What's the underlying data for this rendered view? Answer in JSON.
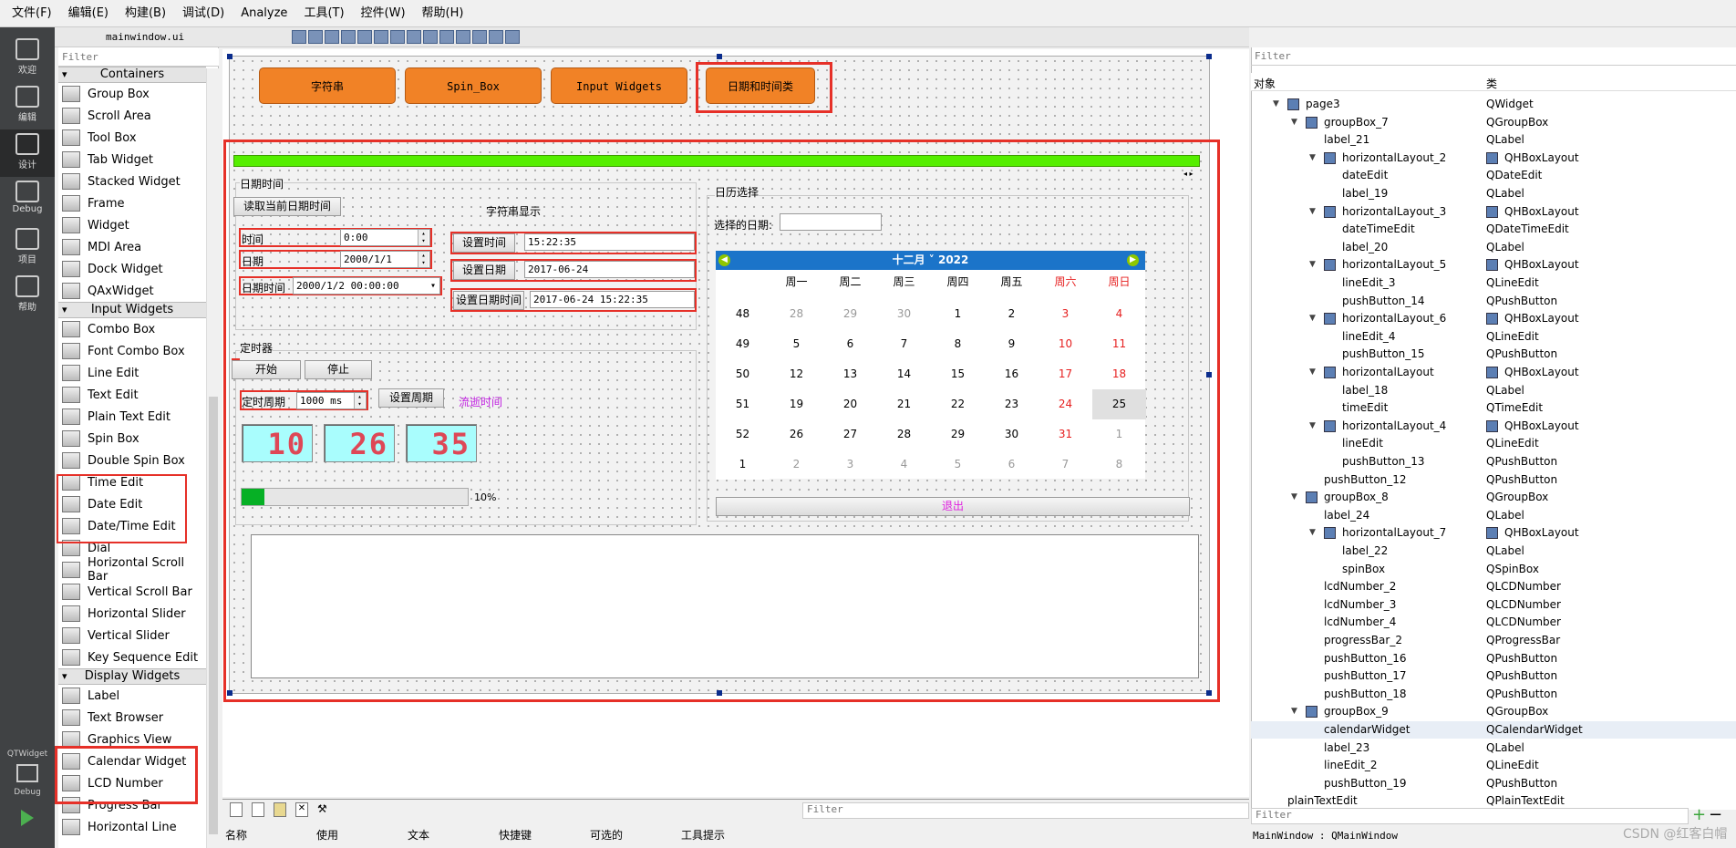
{
  "menubar": [
    "文件(F)",
    "编辑(E)",
    "构建(B)",
    "调试(D)",
    "Analyze",
    "工具(T)",
    "控件(W)",
    "帮助(H)"
  ],
  "modes": [
    {
      "label": "欢迎"
    },
    {
      "label": "编辑"
    },
    {
      "label": "设计",
      "selected": true
    },
    {
      "label": "Debug"
    },
    {
      "label": "项目"
    },
    {
      "label": "帮助"
    }
  ],
  "kit": {
    "name": "QTWidget",
    "label": "Debug"
  },
  "widgetbox": {
    "filter_placeholder": "Filter",
    "categories": [
      {
        "name": "Containers",
        "items": [
          "Group Box",
          "Scroll Area",
          "Tool Box",
          "Tab Widget",
          "Stacked Widget",
          "Frame",
          "Widget",
          "MDI Area",
          "Dock Widget",
          "QAxWidget"
        ]
      },
      {
        "name": "Input Widgets",
        "items": [
          "Combo Box",
          "Font Combo Box",
          "Line Edit",
          "Text Edit",
          "Plain Text Edit",
          "Spin Box",
          "Double Spin Box",
          "Time Edit",
          "Date Edit",
          "Date/Time Edit",
          "Dial",
          "Horizontal Scroll Bar",
          "Vertical Scroll Bar",
          "Horizontal Slider",
          "Vertical Slider",
          "Key Sequence Edit"
        ]
      },
      {
        "name": "Display Widgets",
        "items": [
          "Label",
          "Text Browser",
          "Graphics View",
          "Calendar Widget",
          "LCD Number",
          "Progress Bar",
          "Horizontal Line"
        ]
      }
    ]
  },
  "editor": {
    "file": "mainwindow.ui"
  },
  "form": {
    "tabs": [
      "字符串",
      "Spin_Box",
      "Input Widgets",
      "日期和时间类"
    ],
    "datetime_group": {
      "title": "日期时间",
      "read_button": "读取当前日期时间",
      "string_title": "字符串显示",
      "time_label": "时间",
      "time_value": "0:00",
      "date_label": "日期",
      "date_value": "2000/1/1",
      "datetime_label": "日期时间",
      "datetime_value": "2000/1/2 00:00:00",
      "set_time_button": "设置时间",
      "set_time_value": "15:22:35",
      "set_date_button": "设置日期",
      "set_date_value": "2017-06-24",
      "set_datetime_button": "设置日期时间",
      "set_datetime_value": "2017-06-24 15:22:35"
    },
    "timer_group": {
      "title": "定时器",
      "start": "开始",
      "stop": "停止",
      "period_label": "定时周期",
      "period_value": "1000 ms",
      "set_period": "设置周期",
      "elapsed": "流逝时间",
      "lcd": [
        "10",
        "26",
        "35"
      ],
      "progress": 0.1,
      "progress_text": "10%"
    },
    "calendar_group": {
      "title": "日历选择",
      "date_label": "选择的日期:",
      "date_value": "",
      "month": "十二月",
      "year": "2022",
      "weekdays": [
        "周一",
        "周二",
        "周三",
        "周四",
        "周五",
        "周六",
        "周日"
      ],
      "weeks": [
        "48",
        "49",
        "50",
        "51",
        "52",
        "1"
      ],
      "days": [
        [
          "28",
          "29",
          "30",
          "1",
          "2",
          "3",
          "4"
        ],
        [
          "5",
          "6",
          "7",
          "8",
          "9",
          "10",
          "11"
        ],
        [
          "12",
          "13",
          "14",
          "15",
          "16",
          "17",
          "18"
        ],
        [
          "19",
          "20",
          "21",
          "22",
          "23",
          "24",
          "25"
        ],
        [
          "26",
          "27",
          "28",
          "29",
          "30",
          "31",
          "1"
        ],
        [
          "2",
          "3",
          "4",
          "5",
          "6",
          "7",
          "8"
        ]
      ],
      "exit_button": "退出"
    }
  },
  "object_inspector": {
    "filter_placeholder": "Filter",
    "headers": [
      "对象",
      "类"
    ],
    "rows": [
      [
        "page3",
        "QWidget"
      ],
      [
        "groupBox_7",
        "QGroupBox"
      ],
      [
        "label_21",
        "QLabel"
      ],
      [
        "horizontalLayout_2",
        "QHBoxLayout"
      ],
      [
        "dateEdit",
        "QDateEdit"
      ],
      [
        "label_19",
        "QLabel"
      ],
      [
        "horizontalLayout_3",
        "QHBoxLayout"
      ],
      [
        "dateTimeEdit",
        "QDateTimeEdit"
      ],
      [
        "label_20",
        "QLabel"
      ],
      [
        "horizontalLayout_5",
        "QHBoxLayout"
      ],
      [
        "lineEdit_3",
        "QLineEdit"
      ],
      [
        "pushButton_14",
        "QPushButton"
      ],
      [
        "horizontalLayout_6",
        "QHBoxLayout"
      ],
      [
        "lineEdit_4",
        "QLineEdit"
      ],
      [
        "pushButton_15",
        "QPushButton"
      ],
      [
        "horizontalLayout",
        "QHBoxLayout"
      ],
      [
        "label_18",
        "QLabel"
      ],
      [
        "timeEdit",
        "QTimeEdit"
      ],
      [
        "horizontalLayout_4",
        "QHBoxLayout"
      ],
      [
        "lineEdit",
        "QLineEdit"
      ],
      [
        "pushButton_13",
        "QPushButton"
      ],
      [
        "pushButton_12",
        "QPushButton"
      ],
      [
        "groupBox_8",
        "QGroupBox"
      ],
      [
        "label_24",
        "QLabel"
      ],
      [
        "horizontalLayout_7",
        "QHBoxLayout"
      ],
      [
        "label_22",
        "QLabel"
      ],
      [
        "spinBox",
        "QSpinBox"
      ],
      [
        "lcdNumber_2",
        "QLCDNumber"
      ],
      [
        "lcdNumber_3",
        "QLCDNumber"
      ],
      [
        "lcdNumber_4",
        "QLCDNumber"
      ],
      [
        "progressBar_2",
        "QProgressBar"
      ],
      [
        "pushButton_16",
        "QPushButton"
      ],
      [
        "pushButton_17",
        "QPushButton"
      ],
      [
        "pushButton_18",
        "QPushButton"
      ],
      [
        "groupBox_9",
        "QGroupBox"
      ],
      [
        "calendarWidget",
        "QCalendarWidget"
      ],
      [
        "label_23",
        "QLabel"
      ],
      [
        "lineEdit_2",
        "QLineEdit"
      ],
      [
        "pushButton_19",
        "QPushButton"
      ],
      [
        "plainTextEdit",
        "QPlainTextEdit"
      ]
    ]
  },
  "action_editor": {
    "filter_placeholder": "Filter",
    "columns": [
      "名称",
      "使用",
      "文本",
      "快捷键",
      "可选的",
      "工具提示"
    ]
  },
  "property_editor": {
    "filter_placeholder": "Filter",
    "status": "MainWindow : QMainWindow"
  },
  "watermark": "CSDN @红客白帽",
  "colors": {
    "accent_orange": "#f18226",
    "highlight_red": "#e63028",
    "progress_green": "#55ee00",
    "calendar_header": "#1b74c9",
    "lcd_bg": "#a9fdfd"
  }
}
